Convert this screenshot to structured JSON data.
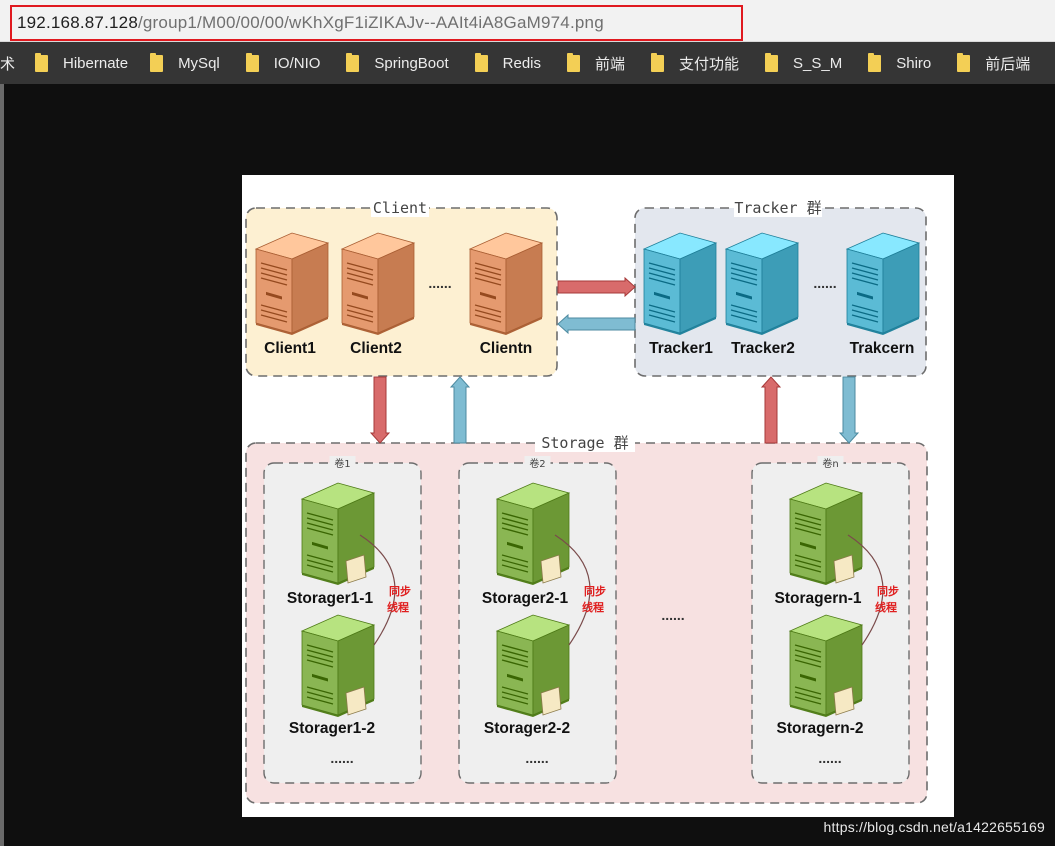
{
  "address_bar": {
    "url_host": "192.168.87.128",
    "url_path": "/group1/M00/00/00/wKhXgF1iZIKAJv--AAIt4iA8GaM974.png"
  },
  "bookmarks": [
    {
      "label": "术",
      "has_folder": false
    },
    {
      "label": "Hibernate",
      "has_folder": true
    },
    {
      "label": "MySql",
      "has_folder": true
    },
    {
      "label": "IO/NIO",
      "has_folder": true
    },
    {
      "label": "SpringBoot",
      "has_folder": true
    },
    {
      "label": "Redis",
      "has_folder": true
    },
    {
      "label": "前端",
      "has_folder": true
    },
    {
      "label": "支付功能",
      "has_folder": true
    },
    {
      "label": "S_S_M",
      "has_folder": true
    },
    {
      "label": "Shiro",
      "has_folder": true
    },
    {
      "label": "前后端",
      "has_folder": true
    }
  ],
  "diagram": {
    "client_group": {
      "title": "Client",
      "nodes": [
        "Client1",
        "Client2",
        "Clientn"
      ],
      "ellipsis": "......"
    },
    "tracker_group": {
      "title": "Tracker 群",
      "nodes": [
        "Tracker1",
        "Tracker2",
        "Trakcern"
      ],
      "ellipsis": "......"
    },
    "storage_group": {
      "title": "Storage 群",
      "volume_ellipsis": "......",
      "volumes": [
        {
          "label": "卷1",
          "top": "Storager1-1",
          "bottom": "Storager1-2",
          "sync": [
            "同步",
            "线程"
          ],
          "more": "......"
        },
        {
          "label": "卷2",
          "top": "Storager2-1",
          "bottom": "Storager2-2",
          "sync": [
            "同步",
            "线程"
          ],
          "more": "......"
        },
        {
          "label": "卷n",
          "top": "Storagern-1",
          "bottom": "Storagern-2",
          "sync": [
            "同步",
            "线程"
          ],
          "more": "......"
        }
      ]
    },
    "colors": {
      "client_bg": "#fdf0d2",
      "tracker_bg": "#e3e7ee",
      "storage_bg": "#f7e1e1",
      "volume_bg": "#efefef",
      "arrow_red": "#d86b6b",
      "arrow_blue": "#7fbcd2",
      "server_orange": "#e59a6f",
      "server_blue": "#5bbbd5",
      "server_green": "#8ab653"
    }
  },
  "watermark": "https://blog.csdn.net/a1422655169"
}
